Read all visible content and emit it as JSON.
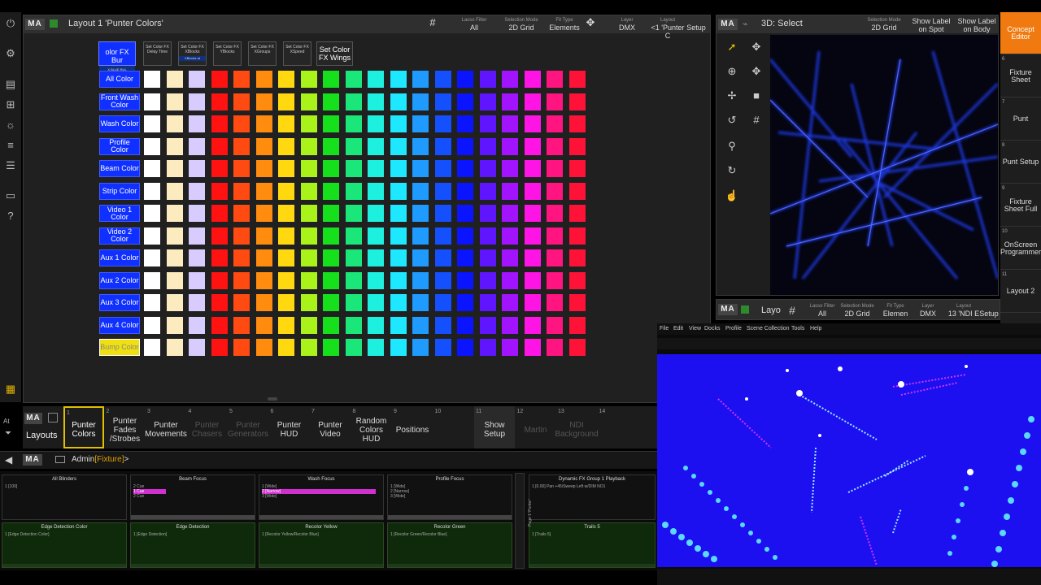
{
  "main_window": {
    "logo": "MA",
    "title": "Layout 1 'Punter Colors'",
    "header": [
      {
        "small": "",
        "value": "#",
        "key": "grid"
      },
      {
        "small": "Lasso Filter",
        "value": "All"
      },
      {
        "small": "Selection Mode",
        "value": "2D Grid"
      },
      {
        "small": "Fit Type",
        "value": "Elements"
      },
      {
        "small": "",
        "value": "✥",
        "key": "move"
      },
      {
        "small": "Layer",
        "value": "DMX"
      },
      {
        "small": "Layout",
        "value": "<1 'Punter C"
      },
      {
        "small": "",
        "value": "Setup"
      }
    ],
    "top_buttons": [
      {
        "label": "olor FX Bur",
        "sub": "X BLUE RUL"
      },
      {
        "label": "Set Color FX Delay Time"
      },
      {
        "label": "Set Color FX XBlocks",
        "sub": "XBlocks at"
      },
      {
        "label": "Set Color FX YBlocks"
      },
      {
        "label": "Set Color FX XGroups"
      },
      {
        "label": "Set Color FX XSpeed"
      },
      {
        "label": "Set Color FX Wings"
      }
    ],
    "rows": [
      "All Color",
      "Front Wash Color",
      "Wash Color",
      "Profile Color",
      "Beam Color",
      "Strip Color",
      "Video 1 Color",
      "Video 2 Color",
      "Aux 1 Color",
      "Aux 2 Color",
      "Aux 3 Color",
      "Aux 4 Color",
      "Bump Color"
    ],
    "swatch_colors": [
      "#ffffff",
      "#fdebc0",
      "#d8ccff",
      "#ff1212",
      "#ff4a12",
      "#ff8c0f",
      "#ffd80f",
      "#a9f21a",
      "#16e01c",
      "#1ae67a",
      "#1ef0e0",
      "#1ee8ff",
      "#1f9aff",
      "#1550ff",
      "#0a14ff",
      "#6015ff",
      "#a214ff",
      "#ff14e6",
      "#ff1480",
      "#ff1238"
    ]
  },
  "view3d": {
    "logo": "MA",
    "title": "3D: Select",
    "header": [
      {
        "small": "Selection Mode",
        "value": "2D Grid"
      },
      {
        "small": "",
        "value": "Show Label on Spot"
      },
      {
        "small": "",
        "value": "Show Label on Body"
      }
    ],
    "tools": [
      "pointer-icon",
      "move-icon",
      "target-icon",
      "pan-icon",
      "dolly-icon",
      "camera-icon",
      "rotate-icon",
      "grid-icon",
      "zoom-icon",
      "rotate-view-icon",
      "pointing-hand-icon"
    ]
  },
  "layout_bar2": {
    "logo": "MA",
    "title": "Layo",
    "header": [
      {
        "small": "Lasso Filter",
        "value": "All"
      },
      {
        "small": "Selection Mode",
        "value": "2D Grid"
      },
      {
        "small": "Fit Type",
        "value": "Elemen"
      },
      {
        "small": "Layer",
        "value": "DMX"
      },
      {
        "small": "Layout",
        "value": "13 'NDI E"
      },
      {
        "small": "",
        "value": "Setup"
      }
    ]
  },
  "right_views": [
    {
      "num": "",
      "label": "Concept Editor",
      "active": true
    },
    {
      "num": "6",
      "label": "Fixture Sheet"
    },
    {
      "num": "7",
      "label": "Punt"
    },
    {
      "num": "8",
      "label": "Punt Setup"
    },
    {
      "num": "9",
      "label": "Fixture Sheet Full"
    },
    {
      "num": "10",
      "label": "OnScreen Programmer"
    },
    {
      "num": "11",
      "label": "Layout 2"
    }
  ],
  "view_bar": {
    "logo": "MA",
    "title": "Layouts",
    "items": [
      {
        "num": "1",
        "label": "Punter Colors",
        "active": true
      },
      {
        "num": "2",
        "label": "Punter Fades /Strobes"
      },
      {
        "num": "3",
        "label": "Punter Movements"
      },
      {
        "num": "4",
        "label": "Punter Chasers",
        "dim": true
      },
      {
        "num": "5",
        "label": "Punter Generators",
        "dim": true
      },
      {
        "num": "6",
        "label": "Punter HUD"
      },
      {
        "num": "7",
        "label": "Punter Video"
      },
      {
        "num": "8",
        "label": "Random Colors HUD"
      },
      {
        "num": "9",
        "label": "Positions"
      },
      {
        "num": "10",
        "label": "",
        "dim": true
      },
      {
        "num": "11",
        "label": "Show Setup"
      },
      {
        "num": "12",
        "label": "Martin",
        "dim": true
      },
      {
        "num": "13",
        "label": "NDI Background",
        "dim": true
      },
      {
        "num": "14",
        "label": "",
        "dim": true
      }
    ]
  },
  "command_line": {
    "logo": "MA",
    "prompt": "Admin",
    "target": "[Fixture]",
    "suffix": ">"
  },
  "playbacks_top": [
    {
      "title": "All Blinders",
      "lines": [
        "1 [100]"
      ]
    },
    {
      "title": "Beam Focus",
      "lines": [
        "2 Cue",
        "1 Cue",
        "2 Cue"
      ]
    },
    {
      "title": "Wash Focus",
      "lines": [
        "1 [Wide]",
        "2 [Narrow]",
        "3 [Wide]"
      ]
    },
    {
      "title": "Profile Focus",
      "lines": [
        "1 [Wide]",
        "2 [Narrow]",
        "3 [Wide]"
      ]
    },
    {
      "title": "Dynamic FX Group 1 Playback",
      "lines": [
        "1 [0.00] Pan +45/Sweep Left w/DIM NO1"
      ]
    }
  ],
  "playbacks_bottom": [
    {
      "title": "Edge Detection Color",
      "lines": [
        "1 [Edge Detection Color]"
      ]
    },
    {
      "title": "Edge Detection",
      "lines": [
        "1 [Edge Detection]"
      ]
    },
    {
      "title": "Recolor Yellow",
      "lines": [
        "1 [Recolor Yellow/Recolor Blue]"
      ]
    },
    {
      "title": "Recolor Green",
      "lines": [
        "1 [Recolor Green/Recolor Blue]"
      ]
    },
    {
      "title": "Trails 5",
      "lines": [
        "1 [Trails 5]"
      ]
    }
  ],
  "playback_mid": "Page 1 'Punter'",
  "resolume_menu": [
    "File",
    "Edit",
    "View",
    "Docks",
    "Profile",
    "Scene Collection",
    "Tools",
    "Help"
  ]
}
